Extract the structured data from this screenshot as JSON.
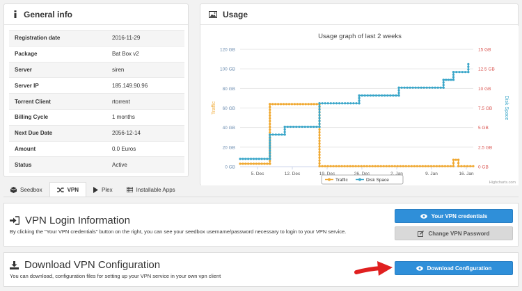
{
  "general": {
    "title": "General info",
    "rows": [
      {
        "k": "Registration date",
        "v": "2016-11-29"
      },
      {
        "k": "Package",
        "v": "Bat Box v2"
      },
      {
        "k": "Server",
        "v": "siren"
      },
      {
        "k": "Server IP",
        "v": "185.149.90.96"
      },
      {
        "k": "Torrent Client",
        "v": "rtorrent"
      },
      {
        "k": "Billing Cycle",
        "v": "1 months"
      },
      {
        "k": "Next Due Date",
        "v": "2056-12-14"
      },
      {
        "k": "Amount",
        "v": "0.0 Euros"
      },
      {
        "k": "Status",
        "v": "Active"
      }
    ]
  },
  "usage": {
    "title": "Usage",
    "credit": "Highcharts.com"
  },
  "chart_data": {
    "type": "line",
    "title": "Usage graph of last 2 weeks",
    "x_ticks": [
      "5. Dec",
      "12. Dec",
      "19. Dec",
      "26. Dec",
      "2. Jan",
      "9. Jan",
      "16. Jan"
    ],
    "xlim": [
      "2016-12-01",
      "2017-01-17"
    ],
    "left_axis": {
      "label": "Traffic",
      "ticks": [
        "0 GB",
        "20 GB",
        "40 GB",
        "60 GB",
        "80 GB",
        "100 GB",
        "120 GB"
      ],
      "ylim": [
        0,
        120
      ],
      "color": "#f0a830"
    },
    "right_axis": {
      "label": "Disk Space",
      "ticks": [
        "0 GB",
        "2.5 GB",
        "5 GB",
        "7.5 GB",
        "10 GB",
        "12.5 GB",
        "15 GB"
      ],
      "ylim": [
        0,
        15
      ],
      "color": "#3aa6c9"
    },
    "legend_position": "bottom-center",
    "series": [
      {
        "name": "Traffic",
        "axis": "left",
        "color": "#f0a830",
        "points": [
          [
            "2016-12-01",
            3
          ],
          [
            "2016-12-07",
            3
          ],
          [
            "2016-12-07",
            64
          ],
          [
            "2016-12-17",
            64
          ],
          [
            "2016-12-17",
            0.5
          ],
          [
            "2017-01-13",
            0.5
          ],
          [
            "2017-01-13",
            7
          ],
          [
            "2017-01-14",
            7
          ],
          [
            "2017-01-14",
            0.5
          ],
          [
            "2017-01-17",
            0.5
          ]
        ]
      },
      {
        "name": "Disk Space",
        "axis": "right",
        "color": "#3aa6c9",
        "points": [
          [
            "2016-12-01",
            1.0
          ],
          [
            "2016-12-07",
            1.0
          ],
          [
            "2016-12-07",
            4.1
          ],
          [
            "2016-12-10",
            4.1
          ],
          [
            "2016-12-10",
            5.1
          ],
          [
            "2016-12-17",
            5.1
          ],
          [
            "2016-12-17",
            8.1
          ],
          [
            "2016-12-25",
            8.1
          ],
          [
            "2016-12-25",
            9.1
          ],
          [
            "2017-01-02",
            9.1
          ],
          [
            "2017-01-02",
            10.1
          ],
          [
            "2017-01-11",
            10.1
          ],
          [
            "2017-01-11",
            11.1
          ],
          [
            "2017-01-13",
            11.1
          ],
          [
            "2017-01-13",
            12.1
          ],
          [
            "2017-01-16",
            12.1
          ],
          [
            "2017-01-16",
            13.1
          ]
        ]
      }
    ]
  },
  "tabs": [
    {
      "label": "Seedbox",
      "icon": "cube-icon"
    },
    {
      "label": "VPN",
      "icon": "shuffle-icon",
      "active": true
    },
    {
      "label": "Plex",
      "icon": "play-icon"
    },
    {
      "label": "Installable Apps",
      "icon": "list-icon"
    }
  ],
  "vpn_login": {
    "title": "VPN Login Information",
    "desc": "By clicking the \"Your VPN credentials\" button on the right, you can see your seedbox username/password necessary to login to your VPN service.",
    "btn_credentials": "Your VPN credentials",
    "btn_change": "Change VPN Password"
  },
  "vpn_download": {
    "title": "Download VPN Configuration",
    "desc": "You can download, configuration files for setting up your VPN service in your own vpn client",
    "btn_download": "Download Configuration"
  },
  "colors": {
    "primary": "#2f8fd9",
    "arrow": "#e02020",
    "traffic": "#f0a830",
    "disk": "#3aa6c9"
  }
}
